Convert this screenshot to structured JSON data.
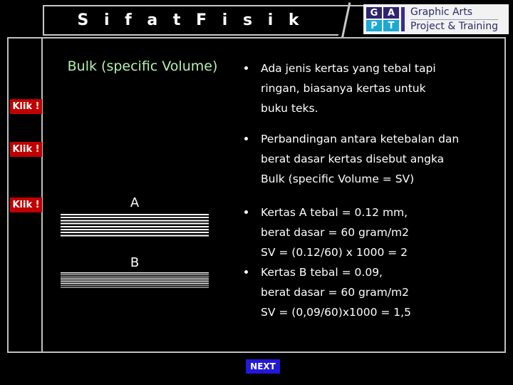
{
  "slide": {
    "title": "S i f a t   F i s i k",
    "heading": "Bulk (specific Volume)"
  },
  "logo": {
    "cells": [
      "G",
      "A",
      "P",
      "T"
    ],
    "line1": "Graphic Arts",
    "line2": "Project & Training",
    "color_dark": "#2e2470",
    "color_cyan": "#1aa9d4",
    "color_text": "#2a2a6a"
  },
  "klik_buttons": [
    {
      "label": "Klik !"
    },
    {
      "label": "Klik !"
    },
    {
      "label": "Klik !"
    }
  ],
  "bullets_upper": [
    {
      "lines": [
        "Ada jenis kertas yang tebal tapi",
        "ringan, biasanya kertas untuk",
        "buku teks."
      ]
    },
    {
      "lines": [
        "Perbandingan antara ketebalan dan",
        "berat dasar kertas disebut angka",
        "Bulk (specific Volume = SV)"
      ]
    }
  ],
  "bullets_lower": [
    {
      "lines": [
        "Kertas A tebal = 0.12 mm,",
        "berat dasar = 60 gram/m2",
        "SV = (0.12/60) x 1000 = 2"
      ]
    },
    {
      "lines": [
        "Kertas B tebal = 0.09,",
        "berat dasar = 60 gram/m2",
        "SV =  (0,09/60)x1000 = 1,5"
      ]
    }
  ],
  "diagram": {
    "stack_a_label": "A",
    "stack_b_label": "B"
  },
  "navigation": {
    "next_label": "NEXT",
    "next_color": "#2318d8"
  },
  "colors": {
    "background": "#000000",
    "frame": "#c0c0c0",
    "heading": "#b4f0b4",
    "klik_bg": "#c00000",
    "body_text": "#ffffff"
  }
}
